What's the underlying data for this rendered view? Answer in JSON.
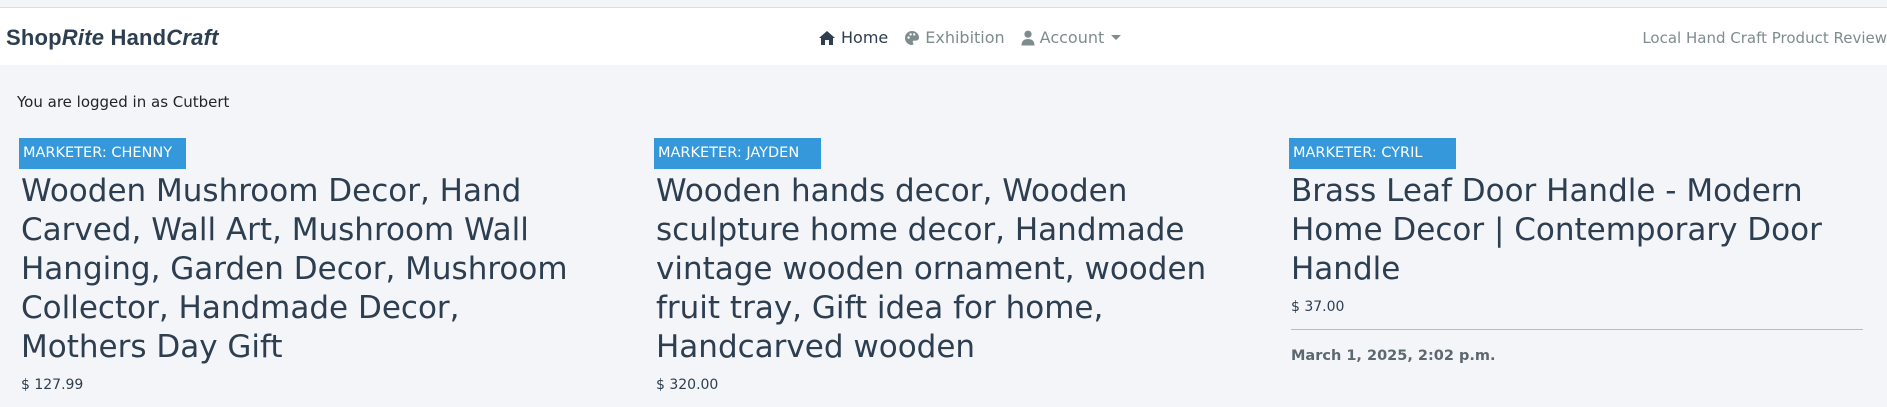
{
  "navbar": {
    "brand": {
      "part1": "Shop",
      "part2": "Rite",
      "part3": " Hand",
      "part4": "Craft"
    },
    "links": [
      {
        "label": "Home",
        "icon": "home-icon",
        "active": true
      },
      {
        "label": "Exhibition",
        "icon": "palette-icon",
        "active": false
      },
      {
        "label": "Account",
        "icon": "user-icon",
        "active": false
      }
    ],
    "tagline": "Local Hand Craft Product Review"
  },
  "login_message": "You are logged in as Cutbert",
  "products": [
    {
      "marketer": "MARKETER: CHENNY",
      "title": "Wooden Mushroom Decor, Hand Carved, Wall Art, Mushroom Wall Hanging, Garden Decor, Mushroom Collector, Handmade Decor, Mothers Day Gift",
      "price": "$ 127.99"
    },
    {
      "marketer": "MARKETER: JAYDEN",
      "title": "Wooden hands decor, Wooden sculpture home decor, Handmade vintage wooden ornament, wooden fruit tray, Gift idea for home, Handcarved wooden",
      "price": "$ 320.00"
    },
    {
      "marketer": "MARKETER: CYRIL",
      "title": "Brass Leaf Door Handle - Modern Home Decor | Contemporary Door Handle",
      "price": "$ 37.00",
      "date": "March 1, 2025, 2:02 p.m."
    }
  ],
  "colors": {
    "brand": "#2c3e50",
    "badge": "#3498db",
    "muted": "#7f8c8d",
    "page_bg": "#f4f5f9"
  }
}
